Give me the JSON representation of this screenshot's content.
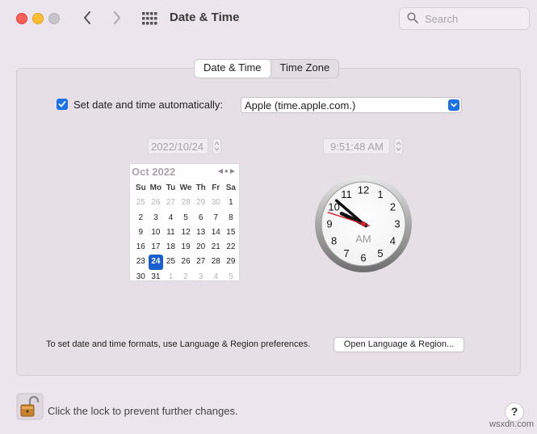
{
  "window": {
    "title": "Date & Time"
  },
  "search": {
    "placeholder": "Search"
  },
  "tabs": [
    {
      "label": "Date & Time",
      "active": true
    },
    {
      "label": "Time Zone",
      "active": false
    }
  ],
  "auto": {
    "checked": true,
    "label": "Set date and time automatically:",
    "server": "Apple (time.apple.com.)"
  },
  "date_field": {
    "value": "2022/10/24"
  },
  "time_field": {
    "value": "9:51:48 AM"
  },
  "calendar": {
    "month_label": "Oct 2022",
    "weekdays": [
      "Su",
      "Mo",
      "Tu",
      "We",
      "Th",
      "Fr",
      "Sa"
    ],
    "weeks": [
      [
        "25",
        "26",
        "27",
        "28",
        "29",
        "30",
        "1"
      ],
      [
        "2",
        "3",
        "4",
        "5",
        "6",
        "7",
        "8"
      ],
      [
        "9",
        "10",
        "11",
        "12",
        "13",
        "14",
        "15"
      ],
      [
        "16",
        "17",
        "18",
        "19",
        "20",
        "21",
        "22"
      ],
      [
        "23",
        "24",
        "25",
        "26",
        "27",
        "28",
        "29"
      ],
      [
        "30",
        "31",
        "1",
        "2",
        "3",
        "4",
        "5"
      ]
    ],
    "selected": "24"
  },
  "clock": {
    "numerals": [
      "12",
      "1",
      "2",
      "3",
      "4",
      "5",
      "6",
      "7",
      "8",
      "9",
      "10",
      "11"
    ],
    "period": "AM",
    "hours": 9,
    "minutes": 51,
    "seconds": 48
  },
  "footer_panel": {
    "note": "To set date and time formats, use Language & Region preferences.",
    "button": "Open Language & Region..."
  },
  "lock": {
    "text": "Click the lock to prevent further changes."
  },
  "help": {
    "label": "?"
  },
  "watermark": "wsxdn.com",
  "colors": {
    "accent": "#1a73e8",
    "selected_day": "#1a5fd1",
    "second_hand": "#d62030"
  }
}
